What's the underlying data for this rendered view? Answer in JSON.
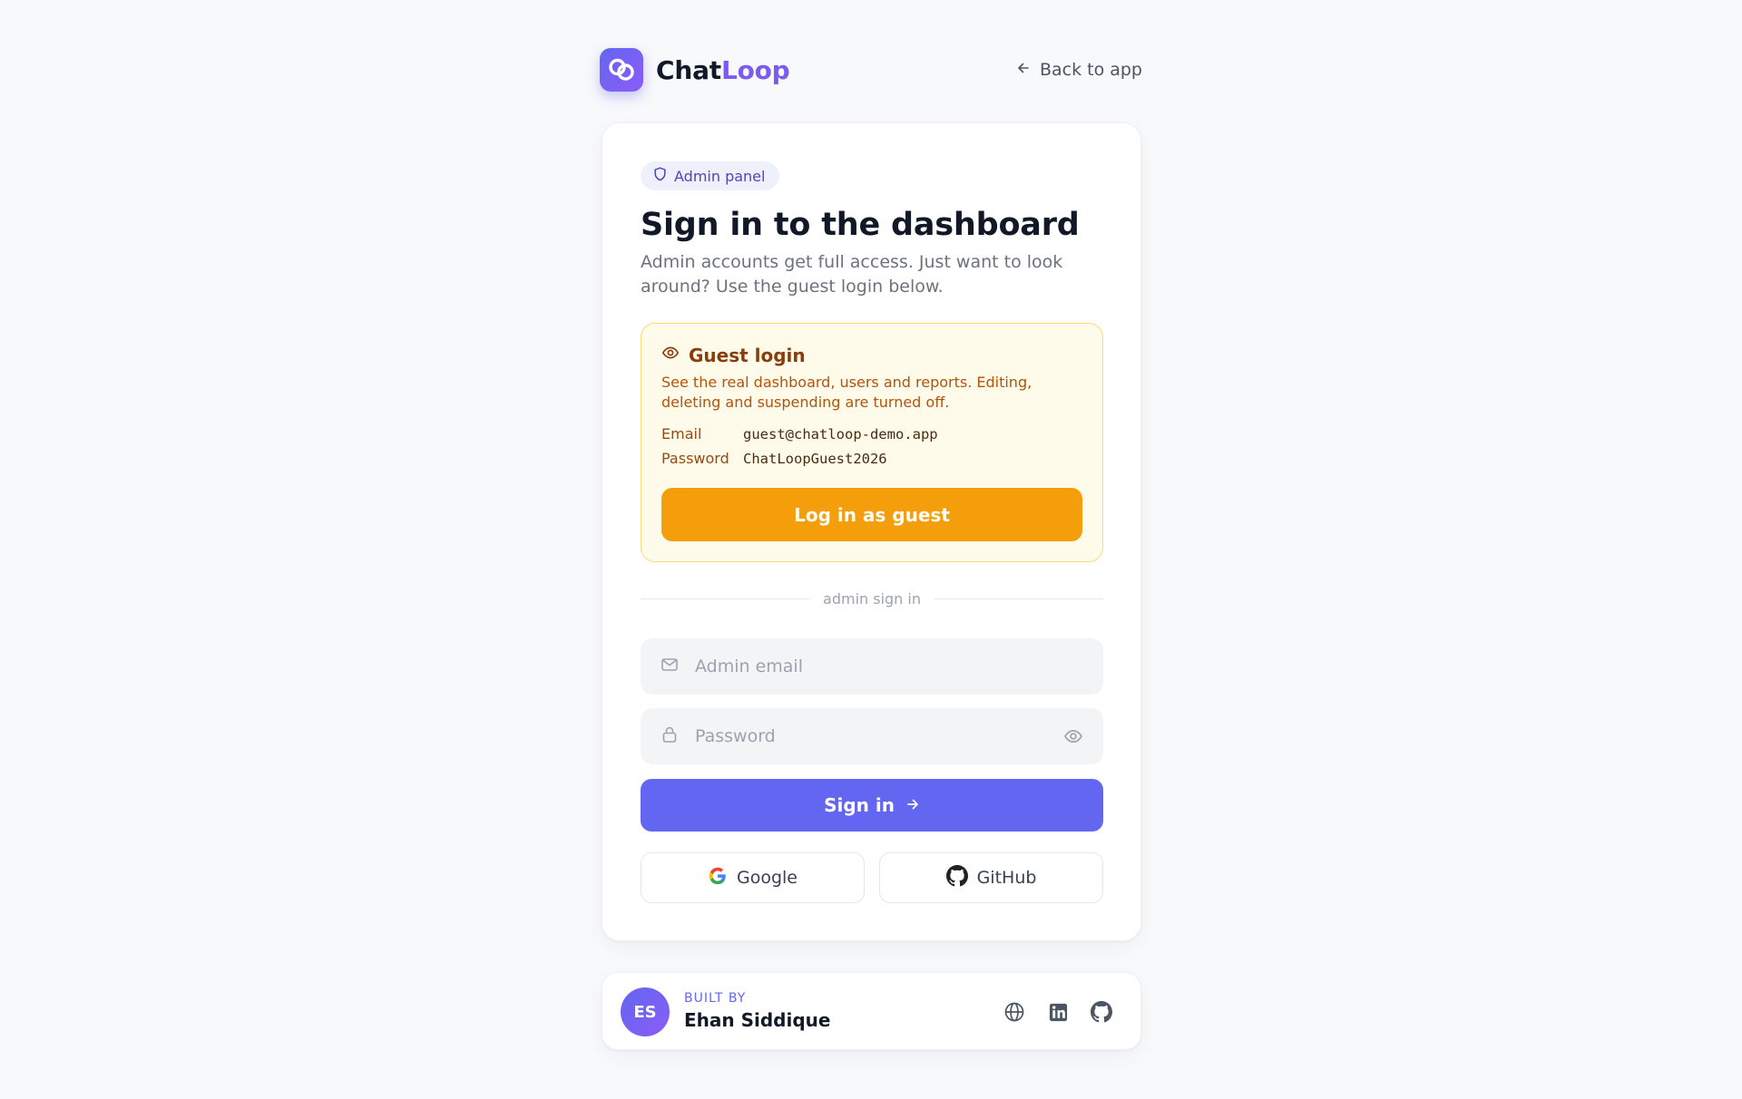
{
  "brand": {
    "name_part1": "Chat",
    "name_part2": "Loop",
    "logo_icon": "chat-bubbles-icon"
  },
  "nav": {
    "back_label": "Back to app"
  },
  "card": {
    "badge": "Admin panel",
    "title": "Sign in to the dashboard",
    "subtitle": "Admin accounts get full access. Just want to look around? Use the guest login below."
  },
  "guest": {
    "heading": "Guest login",
    "description": "See the real dashboard, users and reports. Editing, deleting and suspending are turned off.",
    "email_label": "Email",
    "email_value": "guest@chatloop-demo.app",
    "password_label": "Password",
    "password_value": "ChatLoopGuest2026",
    "button_label": "Log in as guest"
  },
  "admin": {
    "divider_label": "admin sign in",
    "email_placeholder": "Admin email",
    "password_placeholder": "Password",
    "signin_label": "Sign in",
    "google_label": "Google",
    "github_label": "GitHub"
  },
  "footer": {
    "initials": "ES",
    "built_by": "BUILT BY",
    "author": "Ehan Siddique",
    "social_icons": [
      "globe-icon",
      "linkedin-icon",
      "github-icon"
    ]
  },
  "colors": {
    "accent": "#6366f1",
    "brand_purple": "#7c5cf0",
    "guest_button": "#f59e0b",
    "guest_bg": "#fffbeb",
    "background": "#f8f9fb"
  }
}
